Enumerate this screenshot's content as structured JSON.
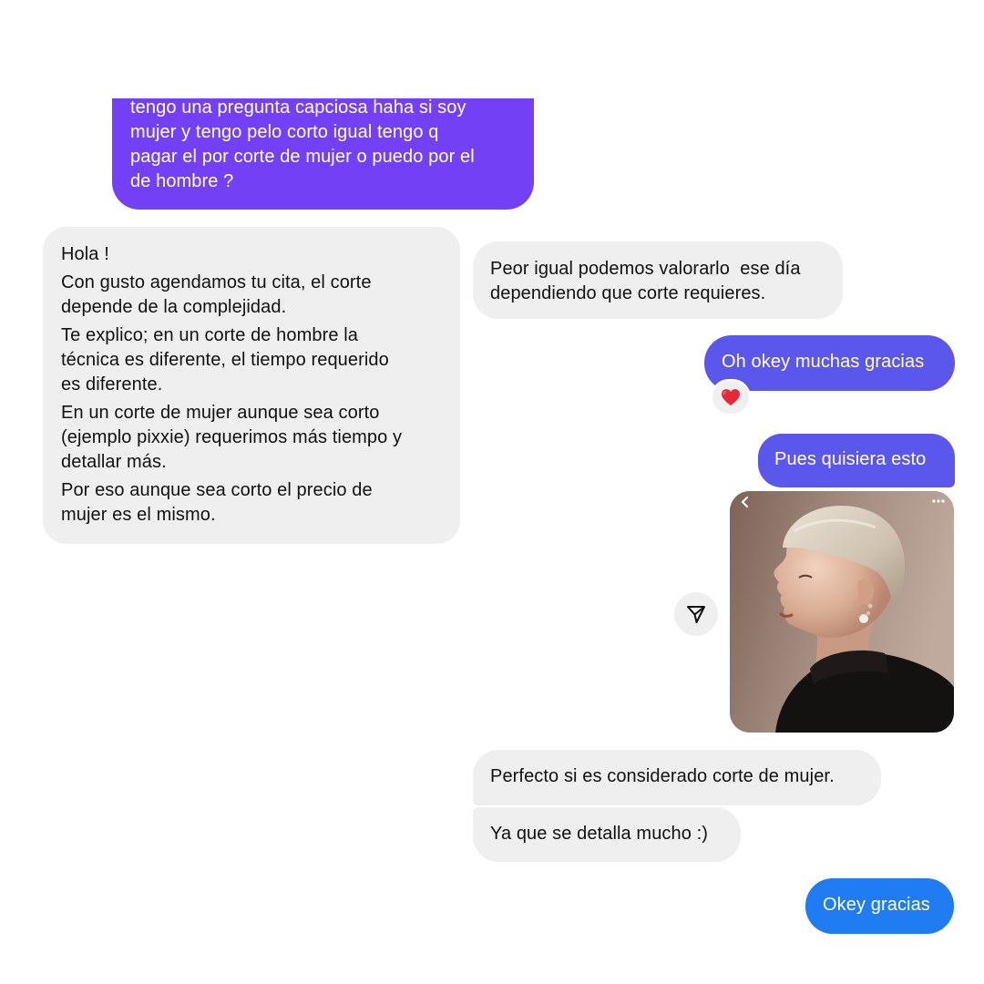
{
  "messages": {
    "m1": {
      "lines": [
        "tengo una pregunta capciosa haha si soy",
        "mujer y tengo pelo corto igual tengo q",
        "pagar el por corte de mujer o puedo por el",
        "de hombre ?"
      ]
    },
    "m2": {
      "paragraphs": [
        {
          "lines": [
            "Hola !"
          ]
        },
        {
          "lines": [
            "Con gusto agendamos tu cita, el corte",
            "depende de la complejidad."
          ]
        },
        {
          "lines": [
            "Te explico; en un corte de hombre la",
            "técnica es diferente, el tiempo requerido",
            "es diferente."
          ]
        },
        {
          "lines": [
            "En un corte de mujer aunque sea corto",
            "(ejemplo pixxie) requerimos más tiempo y",
            "detallar más."
          ]
        },
        {
          "lines": [
            "Por eso aunque sea corto el precio de",
            "mujer es el mismo."
          ]
        }
      ]
    },
    "m3": {
      "lines": [
        "Peor igual podemos valorarlo  ese día",
        "dependiendo que corte requieres."
      ]
    },
    "m4": {
      "text": "Oh okey muchas gracias"
    },
    "m4_reaction": {
      "emoji": "❤️",
      "icon": "heart-reaction-icon"
    },
    "m5": {
      "text": "Pues quisiera esto"
    },
    "shared_post": {
      "back_icon": "chevron-left-icon",
      "more_icon": "more-dots-icon",
      "image": "woman-short-pixie-haircut-profile-photo",
      "share_icon": "send-arrow-icon"
    },
    "m6": {
      "text": "Perfecto si es considerado corte de mujer."
    },
    "m7": {
      "text": "Ya que se detalla mucho :)"
    },
    "m8": {
      "text": "Okey gracias"
    }
  },
  "colors": {
    "sent_purple": "#7440f6",
    "sent_indigo": "#5b56ec",
    "sent_blue": "#1f7cf2",
    "received_bg": "#efefef"
  }
}
